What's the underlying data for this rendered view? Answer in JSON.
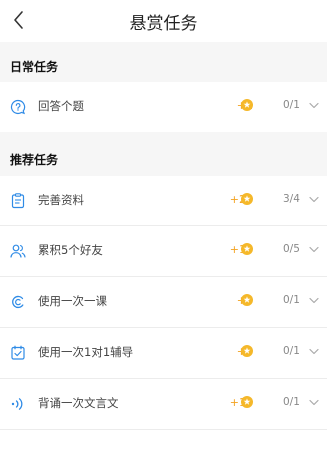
{
  "header": {
    "title": "悬赏任务",
    "back_icon": "back-chevron-icon"
  },
  "colors": {
    "accent": "#2f8be6",
    "reward": "#f3a21f",
    "coin": "#f5b82a",
    "text": "#444444",
    "muted": "#888888"
  },
  "daily": {
    "title": "日常任务",
    "tasks": [
      {
        "icon": "question-circle-icon",
        "label": "回答个题",
        "reward": "+1",
        "progress": "0/1"
      }
    ]
  },
  "recommended": {
    "title": "推荐任务",
    "tasks": [
      {
        "icon": "document-icon",
        "label": "完善资料",
        "reward": "+25",
        "progress": "3/4"
      },
      {
        "icon": "users-icon",
        "label": "累积5个好友",
        "reward": "+10",
        "progress": "0/5"
      },
      {
        "icon": "course-icon",
        "label": "使用一次一课",
        "reward": "+5",
        "progress": "0/1"
      },
      {
        "icon": "tutor-icon",
        "label": "使用一次1对1辅导",
        "reward": "+5",
        "progress": "0/1"
      },
      {
        "icon": "sound-icon",
        "label": "背诵一次文言文",
        "reward": "+10",
        "progress": "0/1"
      }
    ]
  }
}
